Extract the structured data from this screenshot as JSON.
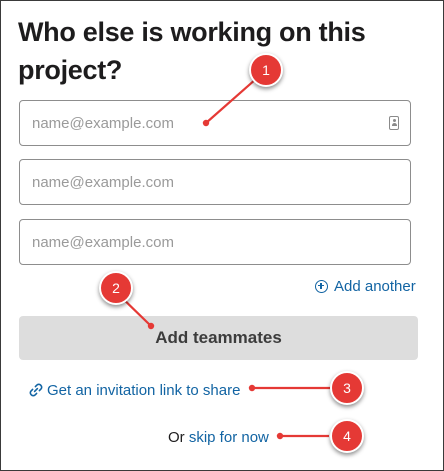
{
  "dialog": {
    "title": "Who else is working on this project?"
  },
  "email_fields": [
    {
      "placeholder": "name@example.com",
      "value": "",
      "has_contact_icon": true
    },
    {
      "placeholder": "name@example.com",
      "value": "",
      "has_contact_icon": false
    },
    {
      "placeholder": "name@example.com",
      "value": "",
      "has_contact_icon": false
    }
  ],
  "actions": {
    "add_another_label": "Add another",
    "add_another_icon": "plus-circle-icon",
    "add_teammates_label": "Add teammates",
    "invite_link_label": "Get an invitation link to share",
    "invite_link_icon": "link-icon",
    "skip_prefix": "Or",
    "skip_label": "skip for now"
  },
  "annotations": {
    "callout_1": "1",
    "callout_2": "2",
    "callout_3": "3",
    "callout_4": "4",
    "color": "#e53935"
  },
  "colors": {
    "link": "#1264a3",
    "button_bg": "#dddddd",
    "text": "#1d1c1d",
    "placeholder": "#9a9a9a"
  }
}
